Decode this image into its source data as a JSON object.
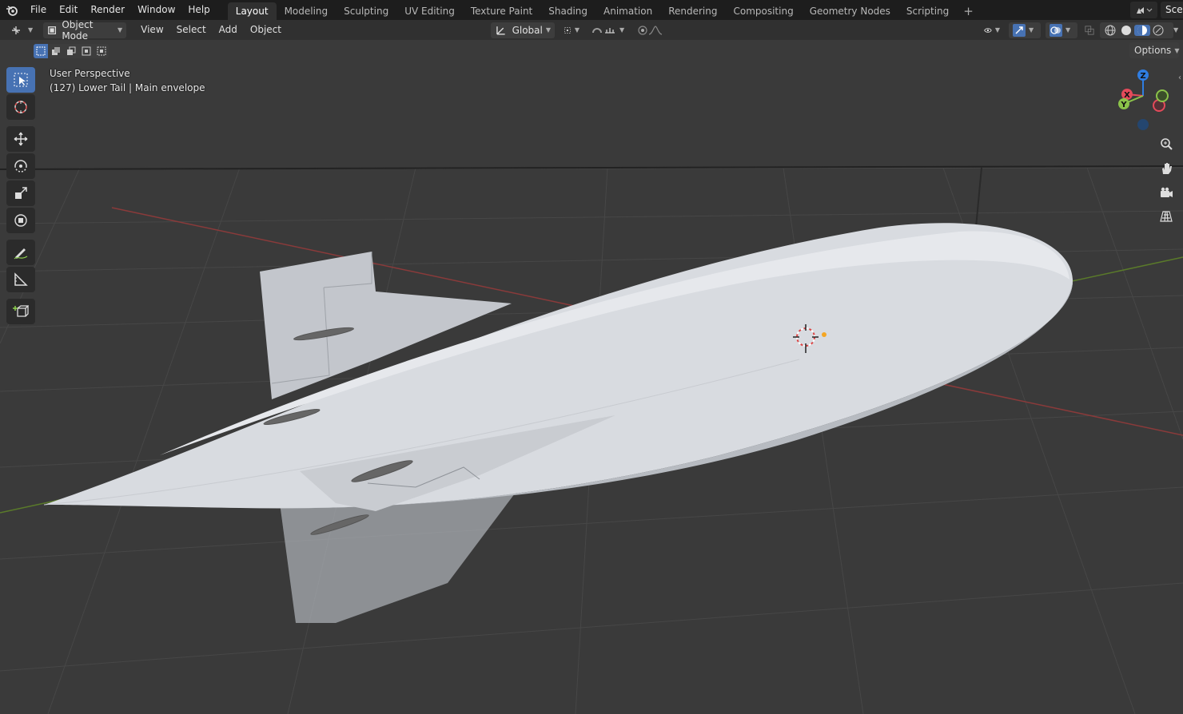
{
  "menus": [
    "File",
    "Edit",
    "Render",
    "Window",
    "Help"
  ],
  "workspace_tabs": [
    "Layout",
    "Modeling",
    "Sculpting",
    "UV Editing",
    "Texture Paint",
    "Shading",
    "Animation",
    "Rendering",
    "Compositing",
    "Geometry Nodes",
    "Scripting"
  ],
  "active_tab": "Layout",
  "scene_label": "Scer",
  "header": {
    "mode": "Object Mode",
    "view_menus": [
      "View",
      "Select",
      "Add",
      "Object"
    ],
    "transform_orientation": "Global",
    "options_label": "Options"
  },
  "viewport": {
    "perspective_label": "User Perspective",
    "object_label": "(127) Lower Tail | Main envelope"
  },
  "gizmo": {
    "x": "X",
    "y": "Y",
    "z": "Z"
  },
  "colors": {
    "accent": "#4772b3",
    "axis_x": "#e44a5a",
    "axis_y": "#8bc34a",
    "axis_z": "#2f7de1",
    "grid_x": "#8a3a3a",
    "grid_y": "#5a7a2a"
  }
}
